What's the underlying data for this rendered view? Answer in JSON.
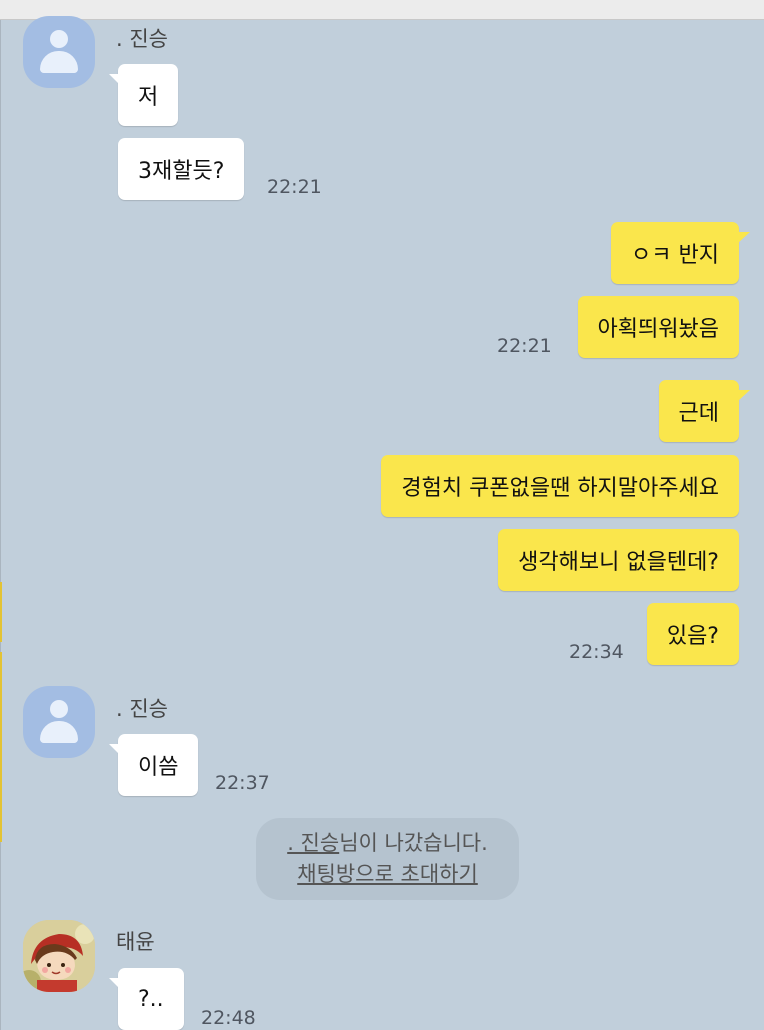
{
  "messages": [
    {
      "sender": ". 진승",
      "texts": [
        "저",
        "3재할듯?"
      ],
      "time": "22:21"
    },
    {
      "sender": "me",
      "texts": [
        "ㅇㅋ 반지",
        "아획띄워놨음"
      ],
      "time": "22:21"
    },
    {
      "sender": "me",
      "texts": [
        "근데",
        "경험치 쿠폰없을땐 하지말아주세요",
        "생각해보니 없을텐데?",
        "있음?"
      ],
      "time": "22:34"
    },
    {
      "sender": ". 진승",
      "texts": [
        "이씀"
      ],
      "time": "22:37"
    },
    {
      "sender": "태윤",
      "texts": [
        "?.."
      ],
      "time": "22:48"
    }
  ],
  "notice": {
    "name_link": ". 진승",
    "suffix": "님이 나갔습니다.",
    "invite_link": "채팅방으로 초대하기"
  },
  "colors": {
    "background": "#c1cfdb",
    "my_bubble": "#fae64c",
    "other_bubble": "#ffffff",
    "avatar_default": "#a3bde3"
  },
  "icons": {
    "default_avatar": "person-silhouette-icon",
    "photo_avatar": "profile-photo-icon"
  }
}
